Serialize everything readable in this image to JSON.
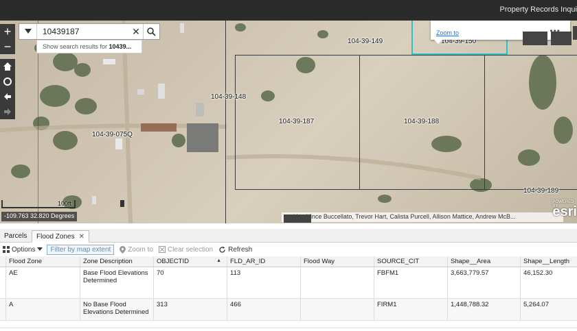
{
  "header": {
    "title": "Property Records Inqui"
  },
  "search": {
    "value": "10439187",
    "suggestion_prefix": "Show search results for ",
    "suggestion_bold": "10439..."
  },
  "popup": {
    "zoom_to": "Zoom to",
    "more": "•••",
    "parcel": "104-39-150"
  },
  "parcels": [
    {
      "label": "104-39-149"
    },
    {
      "label": "104-39-148"
    },
    {
      "label": "104-39-187"
    },
    {
      "label": "104-39-188"
    },
    {
      "label": "104-39-075Q"
    },
    {
      "label": "104-39-189"
    }
  ],
  "map": {
    "scale_label": "100ft",
    "coords": "-109.763 32.820 Degrees",
    "attribution": "..ed by: Vince Buccellato, Trevor Hart, Calista Purcell, Allison Mattice, Andrew McB...",
    "logo": "esri",
    "logo_small": "POWERED BY"
  },
  "tabs": [
    {
      "label": "Parcels",
      "close": "✕"
    },
    {
      "label": "Flood Zones",
      "close": "✕"
    }
  ],
  "toolbar": {
    "options": "Options",
    "filter": "Filter by map extent",
    "zoom_to": "Zoom to",
    "clear_selection": "Clear selection",
    "refresh": "Refresh"
  },
  "table": {
    "columns": [
      "Flood Zone",
      "Zone Description",
      "OBJECTID",
      "FLD_AR_ID",
      "Flood Way",
      "SOURCE_CIT",
      "Shape__Area",
      "Shape__Length"
    ],
    "sort_indicator": "▲",
    "rows": [
      [
        "AE",
        "Base Flood Elevations Determined",
        "70",
        "113",
        "",
        "FBFM1",
        "3,663,779.57",
        "46,152.30"
      ],
      [
        "A",
        "No Base Flood Elevations Determined",
        "313",
        "466",
        "",
        "FIRM1",
        "1,448,788.32",
        "5,264.07"
      ]
    ]
  },
  "icons": {
    "zoom_in": "plus-icon",
    "zoom_out": "minus-icon",
    "home": "home-icon",
    "locate": "locate-icon",
    "back": "arrow-left-icon",
    "forward": "arrow-right-icon",
    "search": "search-icon",
    "clear": "close-icon",
    "dropdown": "chevron-down-icon"
  },
  "colors": {
    "topbar": "#2b2b2b",
    "link": "#2b6fb6",
    "selection": "#2ec4c4"
  }
}
